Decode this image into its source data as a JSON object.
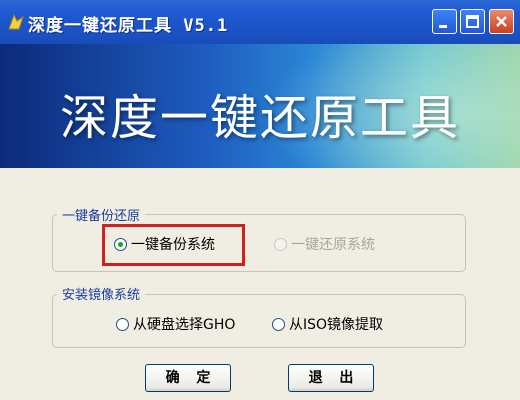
{
  "window": {
    "title": "深度一键还原工具  V5.1",
    "banner_title": "深度一键还原工具"
  },
  "groups": [
    {
      "legend": "一键备份还原",
      "options": [
        {
          "label": "一键备份系统",
          "selected": true,
          "enabled": true
        },
        {
          "label": "一键还原系统",
          "selected": false,
          "enabled": false
        }
      ]
    },
    {
      "legend": "安装镜像系统",
      "options": [
        {
          "label": "从硬盘选择GHO",
          "selected": false,
          "enabled": true
        },
        {
          "label": "从ISO镜像提取",
          "selected": false,
          "enabled": true
        }
      ]
    }
  ],
  "buttons": {
    "ok": "确 定",
    "exit": "退 出"
  },
  "colors": {
    "titlebar": "#1f59d0",
    "highlight_box": "#d12020",
    "group_legend": "#1a3c9c"
  },
  "icons": [
    "app-icon",
    "minimize-icon",
    "maximize-icon",
    "close-icon"
  ]
}
